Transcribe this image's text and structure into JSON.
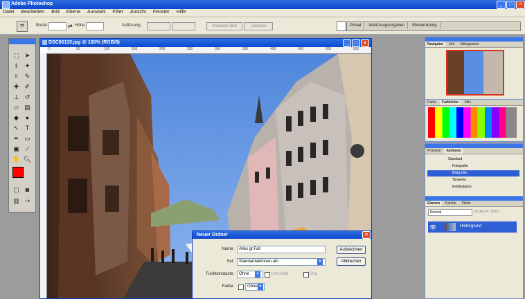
{
  "app": {
    "title": "Adobe Photoshop"
  },
  "menu": [
    "Datei",
    "Bearbeiten",
    "Bild",
    "Ebene",
    "Auswahl",
    "Filter",
    "Ansicht",
    "Fenster",
    "Hilfe"
  ],
  "options": {
    "breite_label": "Breite:",
    "hoehe_label": "Höhe:",
    "aufloesung_label": "Auflösung:",
    "front_button": "Vorderes Bild",
    "delete_button": "Löschen",
    "palette_tabs": [
      "Pinsel",
      "Werkzeugvorgaben",
      "Ebenenkomp."
    ]
  },
  "document": {
    "title": "DSC00115.jpg @ 100% (RGB/8)",
    "ruler_labels": [
      "0",
      "50",
      "100",
      "150",
      "200",
      "250",
      "300",
      "350",
      "400",
      "450",
      "500",
      "550"
    ]
  },
  "navigator": {
    "tabs": [
      "Navigator",
      "Info",
      "Histogramm"
    ]
  },
  "swatches": {
    "tabs": [
      "Farbe",
      "Farbfelder",
      "Stile"
    ]
  },
  "history": {
    "tabs": [
      "Protokoll",
      "Aktionen"
    ],
    "items": [
      "Standard",
      "Fotografie",
      "Bildgröße",
      "Tonwerte",
      "Farbbalance"
    ]
  },
  "layers": {
    "tabs": [
      "Ebenen",
      "Kanäle",
      "Pfade"
    ],
    "mode": "Normal",
    "opacity": "Deckkraft: 100%",
    "layer_name": "Hintergrund"
  },
  "dialog": {
    "title": "Neuer Ordner",
    "name_label": "Name:",
    "name_value": "Alles gr.Fall",
    "set_label": "Set:",
    "set_value": "Standardaktionen.atn",
    "fkey_label": "Funktionstaste:",
    "fkey_value": "Ohne",
    "shift_label": "Umschalt",
    "strg_label": "Strg",
    "color_label": "Farbe:",
    "color_value": "Ohne",
    "record_button": "Aufzeichnen",
    "cancel_button": "Abbrechen"
  },
  "colors": {
    "titlebar": "#1550d6",
    "foreground": "#ff0000",
    "background": "#ffffff",
    "sky": "#5b8ee0"
  }
}
